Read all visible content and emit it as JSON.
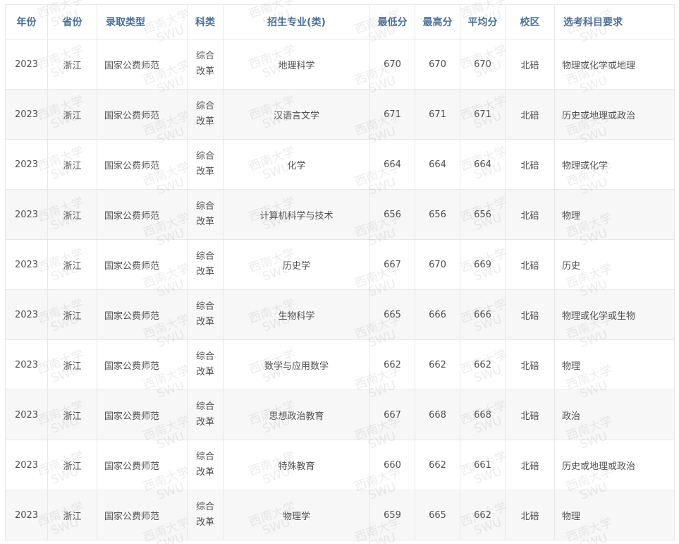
{
  "watermark": {
    "line1": "西南大学",
    "line2": "SWU"
  },
  "headers": [
    "年份",
    "省份",
    "录取类型",
    "科类",
    "招生专业(类)",
    "最低分",
    "最高分",
    "平均分",
    "校区",
    "选考科目要求"
  ],
  "rows": [
    {
      "year": "2023",
      "province": "浙江",
      "type": "国家公费师范",
      "category": "综合改革",
      "major": "地理科学",
      "min": "670",
      "max": "670",
      "avg": "670",
      "campus": "北碚",
      "subjects": "物理或化学或地理"
    },
    {
      "year": "2023",
      "province": "浙江",
      "type": "国家公费师范",
      "category": "综合改革",
      "major": "汉语言文学",
      "min": "671",
      "max": "671",
      "avg": "671",
      "campus": "北碚",
      "subjects": "历史或地理或政治"
    },
    {
      "year": "2023",
      "province": "浙江",
      "type": "国家公费师范",
      "category": "综合改革",
      "major": "化学",
      "min": "664",
      "max": "664",
      "avg": "664",
      "campus": "北碚",
      "subjects": "物理或化学"
    },
    {
      "year": "2023",
      "province": "浙江",
      "type": "国家公费师范",
      "category": "综合改革",
      "major": "计算机科学与技术",
      "min": "656",
      "max": "656",
      "avg": "656",
      "campus": "北碚",
      "subjects": "物理"
    },
    {
      "year": "2023",
      "province": "浙江",
      "type": "国家公费师范",
      "category": "综合改革",
      "major": "历史学",
      "min": "667",
      "max": "670",
      "avg": "669",
      "campus": "北碚",
      "subjects": "历史"
    },
    {
      "year": "2023",
      "province": "浙江",
      "type": "国家公费师范",
      "category": "综合改革",
      "major": "生物科学",
      "min": "665",
      "max": "666",
      "avg": "666",
      "campus": "北碚",
      "subjects": "物理或化学或生物"
    },
    {
      "year": "2023",
      "province": "浙江",
      "type": "国家公费师范",
      "category": "综合改革",
      "major": "数学与应用数学",
      "min": "662",
      "max": "662",
      "avg": "662",
      "campus": "北碚",
      "subjects": "物理"
    },
    {
      "year": "2023",
      "province": "浙江",
      "type": "国家公费师范",
      "category": "综合改革",
      "major": "思想政治教育",
      "min": "667",
      "max": "668",
      "avg": "668",
      "campus": "北碚",
      "subjects": "政治"
    },
    {
      "year": "2023",
      "province": "浙江",
      "type": "国家公费师范",
      "category": "综合改革",
      "major": "特殊教育",
      "min": "660",
      "max": "662",
      "avg": "661",
      "campus": "北碚",
      "subjects": "历史或地理或政治"
    },
    {
      "year": "2023",
      "province": "浙江",
      "type": "国家公费师范",
      "category": "综合改革",
      "major": "物理学",
      "min": "659",
      "max": "665",
      "avg": "662",
      "campus": "北碚",
      "subjects": "物理"
    }
  ]
}
